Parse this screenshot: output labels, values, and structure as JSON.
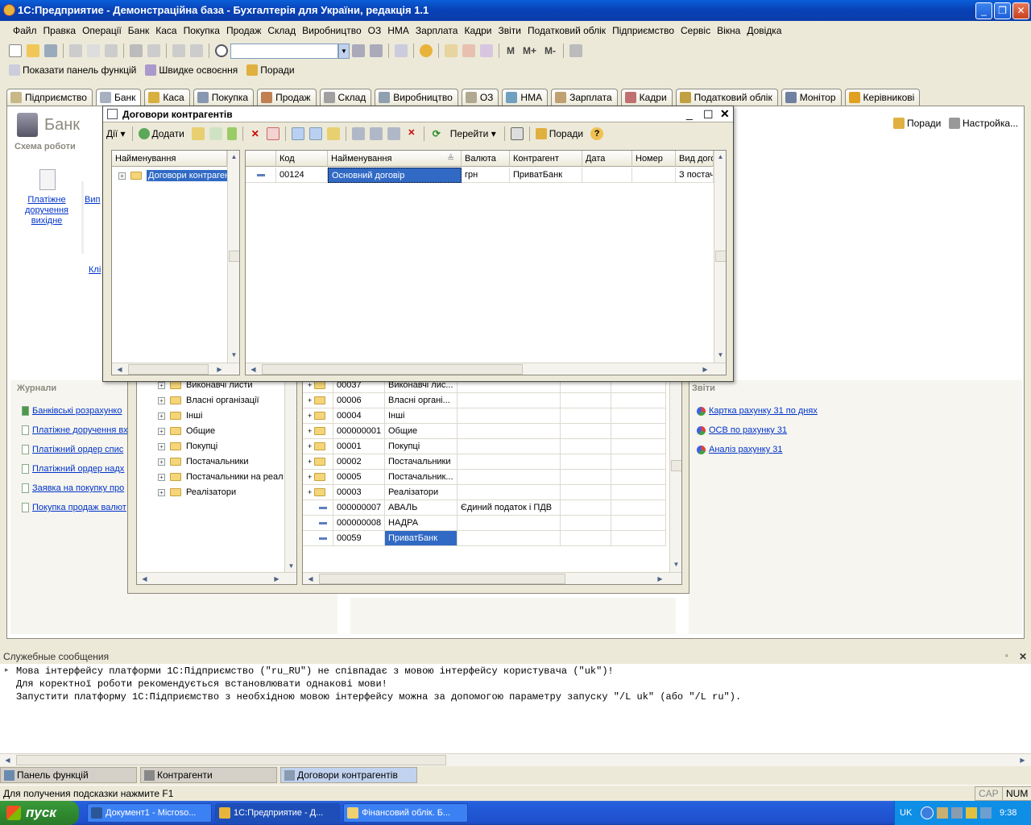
{
  "app": {
    "title": "1С:Предприятие - Демонстраційна база - Бухгалтерія для України, редакція 1.1"
  },
  "menu": [
    "Файл",
    "Правка",
    "Операції",
    "Банк",
    "Каса",
    "Покупка",
    "Продаж",
    "Склад",
    "Виробництво",
    "ОЗ",
    "НМА",
    "Зарплата",
    "Кадри",
    "Звіти",
    "Податковий облік",
    "Підприємство",
    "Сервіс",
    "Вікна",
    "Довідка"
  ],
  "toolbar3": {
    "show_panel": "Показати панель функцій",
    "quick_learning": "Швидке освоєння",
    "tips": "Поради"
  },
  "counters": {
    "m": "M",
    "mplus": "M+",
    "mminus": "M-"
  },
  "main_tabs": [
    "Підприємство",
    "Банк",
    "Каса",
    "Покупка",
    "Продаж",
    "Склад",
    "Виробництво",
    "ОЗ",
    "НМА",
    "Зарплата",
    "Кадри",
    "Податковий облік",
    "Монітор",
    "Керівникові"
  ],
  "bank_panel": {
    "title": "Банк",
    "schema": "Схема роботи",
    "tips": "Поради",
    "settings": "Настройка...",
    "doc_icon_label": "Платіжне доручення вихідне",
    "partial1": "Вип",
    "partial2": "Клі",
    "journals_title": "Журнали",
    "journals": [
      "Банківські розрахунко",
      "Платіжне доручення вх",
      "Платіжний ордер спис",
      "Платіжний ордер надх",
      "Заявка на покупку про",
      "Покупка продаж валют"
    ],
    "reports_title": "Звіти",
    "reports": [
      "Картка рахунку 31 по днях",
      "ОСВ по рахунку 31",
      "Аналіз рахунку 31"
    ]
  },
  "contragents": {
    "tree": [
      "Виконавчі листи",
      "Власні організації",
      "Інші",
      "Общие",
      "Покупці",
      "Постачальники",
      "Постачальники на реал",
      "Реалізатори"
    ],
    "rows": [
      {
        "code": "00037",
        "name": "Виконавчі лис...",
        "extra": ""
      },
      {
        "code": "00006",
        "name": "Власні органі...",
        "extra": ""
      },
      {
        "code": "00004",
        "name": "Інші",
        "extra": ""
      },
      {
        "code": "000000001",
        "name": "Общие",
        "extra": ""
      },
      {
        "code": "00001",
        "name": "Покупці",
        "extra": ""
      },
      {
        "code": "00002",
        "name": "Постачальники",
        "extra": ""
      },
      {
        "code": "00005",
        "name": "Постачальник...",
        "extra": ""
      },
      {
        "code": "00003",
        "name": "Реалізатори",
        "extra": ""
      },
      {
        "code": "000000007",
        "name": "АВАЛЬ",
        "extra": "Єдиний податок і ПДВ"
      },
      {
        "code": "000000008",
        "name": "НАДРА",
        "extra": ""
      },
      {
        "code": "00059",
        "name": "ПриватБанк",
        "extra": ""
      }
    ]
  },
  "contracts": {
    "title": "Договори контрагентів",
    "actions": "Дії",
    "add": "Додати",
    "goto": "Перейти",
    "tips": "Поради",
    "tree_header": "Найменування",
    "tree_item": "Договори контрагентів",
    "columns": [
      "Код",
      "Найменування",
      "Валюта",
      "Контрагент",
      "Дата",
      "Номер",
      "Вид дого"
    ],
    "row": {
      "code": "00124",
      "name": "Основний договір",
      "currency": "грн",
      "contragent": "ПриватБанк",
      "date": "",
      "number": "",
      "kind": "З постач"
    }
  },
  "messages": {
    "title": "Служебные сообщения",
    "lines": [
      "Мова інтерфейсу платформи 1С:Підприємство (\"ru_RU\") не співпадає з мовою інтерфейсу користувача (\"uk\")!",
      "Для коректної роботи рекомендується встановлювати однакові мови!",
      "Запустити платформу 1С:Підприємство з необхідною мовою інтерфейсу можна за допомогою параметру запуску \"/L uk\" (або \"/L ru\")."
    ]
  },
  "window_tabs": [
    "Панель функцій",
    "Контрагенти",
    "Договори контрагентів"
  ],
  "status": {
    "hint": "Для получения подсказки нажмите F1",
    "cap": "CAP",
    "num": "NUM"
  },
  "taskbar": {
    "start": "пуск",
    "tasks": [
      "Документ1 - Microso...",
      "1С:Предприятие - Д...",
      "Фінансовий облік. Б..."
    ],
    "lang": "UK",
    "time": "9:38"
  },
  "colors": {
    "xp_blue": "#0a5fd8",
    "selection": "#316ac5",
    "link": "#0033cc"
  }
}
